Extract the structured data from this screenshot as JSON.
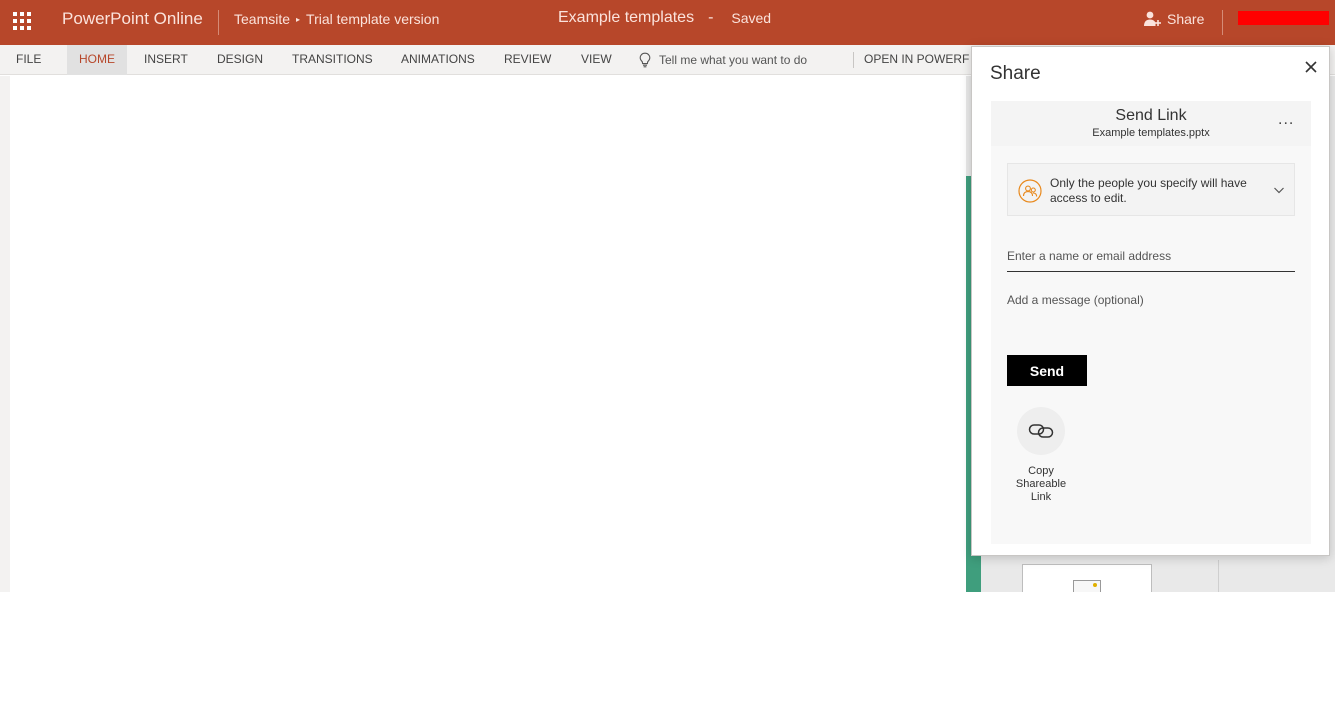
{
  "titlebar": {
    "app_name": "PowerPoint Online",
    "breadcrumb_site": "Teamsite",
    "breadcrumb_separator": "▸",
    "breadcrumb_folder": "Trial template version",
    "doc_title": "Example templates",
    "doc_title_dash": "-",
    "save_status": "Saved",
    "share_label": "Share",
    "accent_color": "#b7472a"
  },
  "ribbon": {
    "tabs": [
      {
        "label": "FILE",
        "active": false
      },
      {
        "label": "HOME",
        "active": true
      },
      {
        "label": "INSERT",
        "active": false
      },
      {
        "label": "DESIGN",
        "active": false
      },
      {
        "label": "TRANSITIONS",
        "active": false
      },
      {
        "label": "ANIMATIONS",
        "active": false
      },
      {
        "label": "REVIEW",
        "active": false
      },
      {
        "label": "VIEW",
        "active": false
      }
    ],
    "tell_me_placeholder": "Tell me what you want to do",
    "open_in_label": "OPEN IN POWERF"
  },
  "share_panel": {
    "title": "Share",
    "send_link_title": "Send Link",
    "file_name": "Example templates.pptx",
    "more_label": "...",
    "permission_text": "Only the people you specify will have access to edit.",
    "recipient_placeholder": "Enter a name or email address",
    "message_placeholder": "Add a message (optional)",
    "send_label": "Send",
    "copy_link_label": "Copy Shareable Link"
  },
  "icons": {
    "app_launcher": "waffle-icon",
    "share": "person-add-icon",
    "tell_me": "lightbulb-icon",
    "close": "close-icon",
    "permission": "people-icon",
    "permission_chevron": "chevron-down-icon",
    "copy_link": "link-icon"
  }
}
